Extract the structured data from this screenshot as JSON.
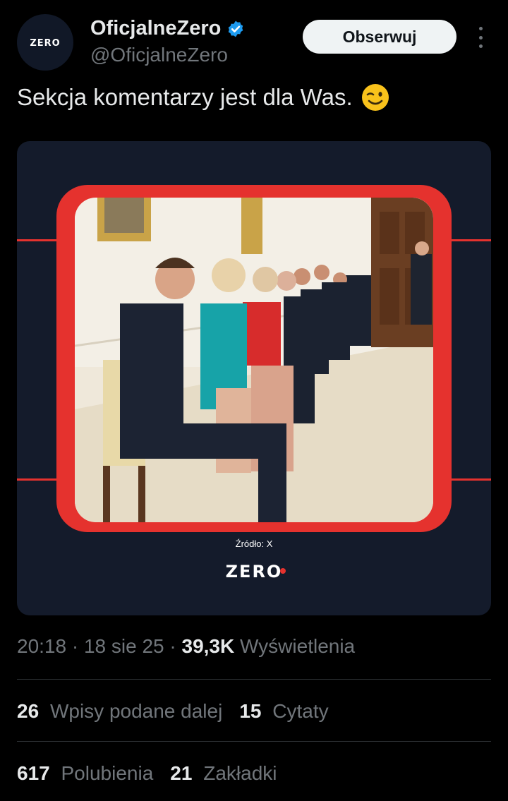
{
  "author": {
    "display_name": "OficjalneZero",
    "handle": "@OficjalneZero",
    "avatar_text": "ZERO",
    "verified": true
  },
  "actions": {
    "follow_label": "Obserwuj"
  },
  "tweet": {
    "text": "Sekcja komentarzy jest dla Was.",
    "emoji": "wink-emoji"
  },
  "media": {
    "source_label": "Źródło: X",
    "brand": "ZERO"
  },
  "meta": {
    "time": "20:18",
    "date": "18 sie 25",
    "views_count": "39,3K",
    "views_label": "Wyświetlenia"
  },
  "stats": {
    "reposts_count": "26",
    "reposts_label": "Wpisy podane dalej",
    "quotes_count": "15",
    "quotes_label": "Cytaty",
    "likes_count": "617",
    "likes_label": "Polubienia",
    "bookmarks_count": "21",
    "bookmarks_label": "Zakładki"
  },
  "colors": {
    "background": "#000000",
    "accent_red": "#e5322e",
    "card_bg": "#141b2b",
    "verified_blue": "#1d9bf0"
  }
}
